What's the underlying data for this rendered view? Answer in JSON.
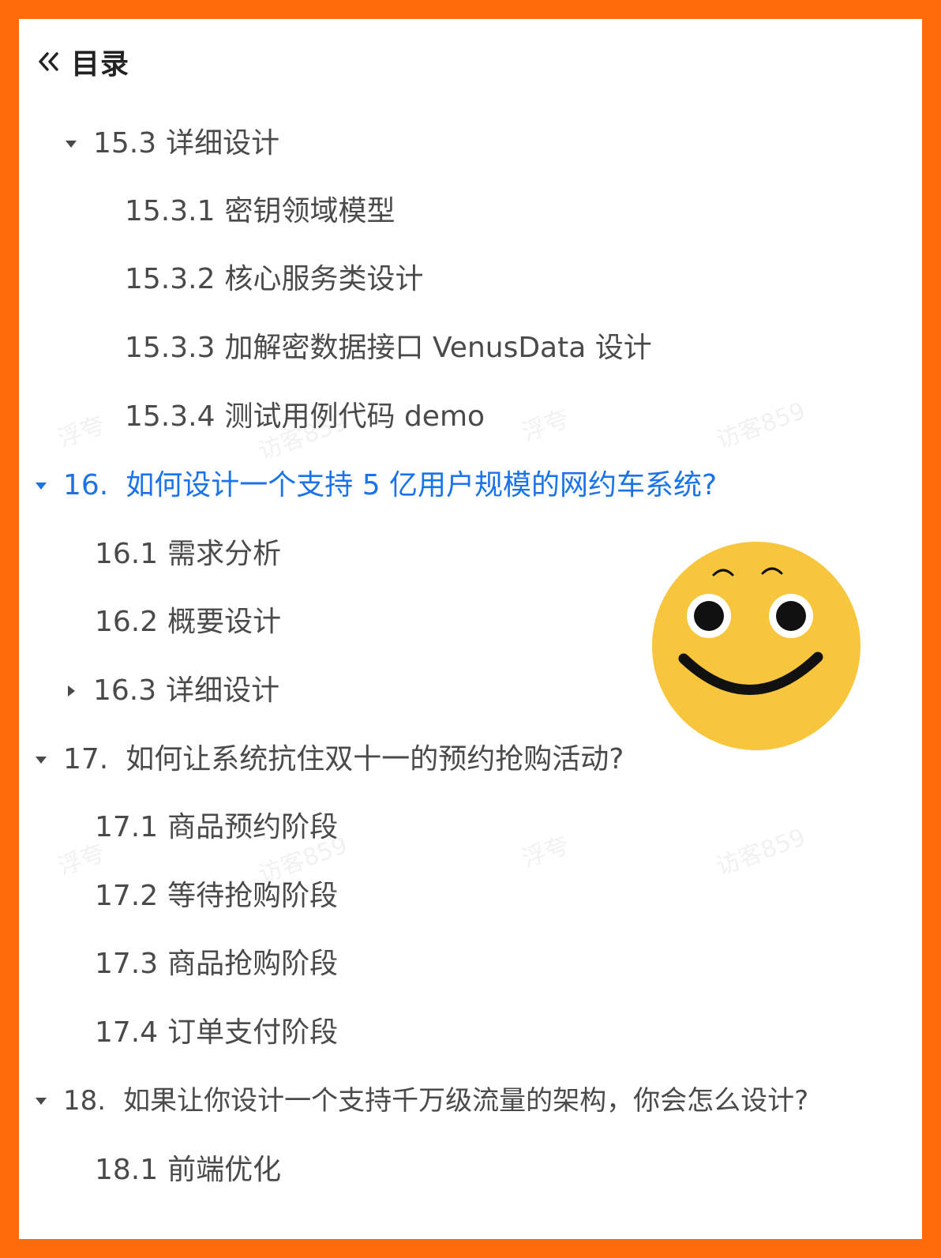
{
  "header": {
    "title": "目录"
  },
  "toc": {
    "items": [
      {
        "number": "15.3",
        "title": "详细设计",
        "caret": "down"
      },
      {
        "number": "15.3.1",
        "title": "密钥领域模型"
      },
      {
        "number": "15.3.2",
        "title": "核心服务类设计"
      },
      {
        "number": "15.3.3",
        "title": "加解密数据接口 VenusData 设计"
      },
      {
        "number": "15.3.4",
        "title": "测试用例代码 demo"
      },
      {
        "number": "16.",
        "title": "如何设计一个支持 5 亿用户规模的网约车系统?",
        "caret": "down",
        "active": true
      },
      {
        "number": "16.1",
        "title": "需求分析"
      },
      {
        "number": "16.2",
        "title": "概要设计"
      },
      {
        "number": "16.3",
        "title": "详细设计",
        "caret": "right"
      },
      {
        "number": "17.",
        "title": "如何让系统抗住双十一的预约抢购活动?",
        "caret": "down"
      },
      {
        "number": "17.1",
        "title": "商品预约阶段"
      },
      {
        "number": "17.2",
        "title": "等待抢购阶段"
      },
      {
        "number": "17.3",
        "title": "商品抢购阶段"
      },
      {
        "number": "17.4",
        "title": "订单支付阶段"
      },
      {
        "number": "18.",
        "title": "如果让你设计一个支持千万级流量的架构，你会怎么设计?",
        "caret": "down"
      },
      {
        "number": "18.1",
        "title": "前端优化"
      }
    ]
  },
  "watermarks": [
    "浮夸",
    "访客859"
  ],
  "colors": {
    "frame": "#ff6a0b",
    "active_text": "#1a73e8",
    "text": "#4a4a4a",
    "smiley_face": "#f7c63d"
  },
  "icons": {
    "collapse": "double-chevron-left-icon",
    "expanded": "caret-down-icon",
    "collapsed": "caret-right-icon",
    "sticker": "smiley-face-icon"
  }
}
